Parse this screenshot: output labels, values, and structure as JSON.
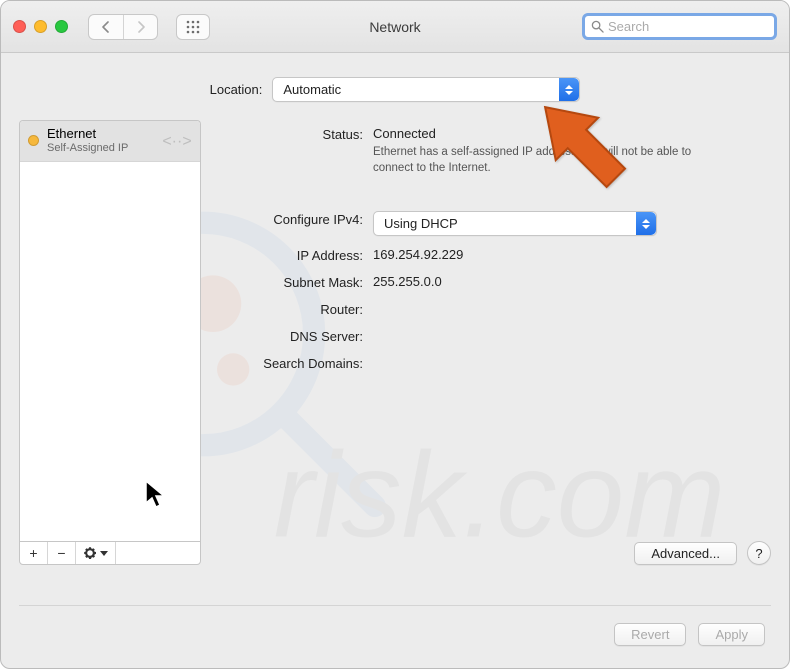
{
  "window": {
    "title": "Network"
  },
  "search": {
    "placeholder": "Search"
  },
  "location": {
    "label": "Location:",
    "value": "Automatic"
  },
  "sidebar": {
    "service": {
      "name": "Ethernet",
      "status": "Self-Assigned IP",
      "status_color": "#f6b83c"
    },
    "buttons": {
      "add": "+",
      "remove": "−"
    }
  },
  "main": {
    "status_label": "Status:",
    "status_value": "Connected",
    "status_desc": "Ethernet has a self-assigned IP address and will not be able to connect to the Internet.",
    "configure_label": "Configure IPv4:",
    "configure_value": "Using DHCP",
    "ip_label": "IP Address:",
    "ip_value": "169.254.92.229",
    "subnet_label": "Subnet Mask:",
    "subnet_value": "255.255.0.0",
    "router_label": "Router:",
    "router_value": "",
    "dns_label": "DNS Server:",
    "dns_value": "",
    "searchdom_label": "Search Domains:",
    "searchdom_value": "",
    "advanced": "Advanced...",
    "help": "?"
  },
  "footer": {
    "revert": "Revert",
    "apply": "Apply"
  }
}
